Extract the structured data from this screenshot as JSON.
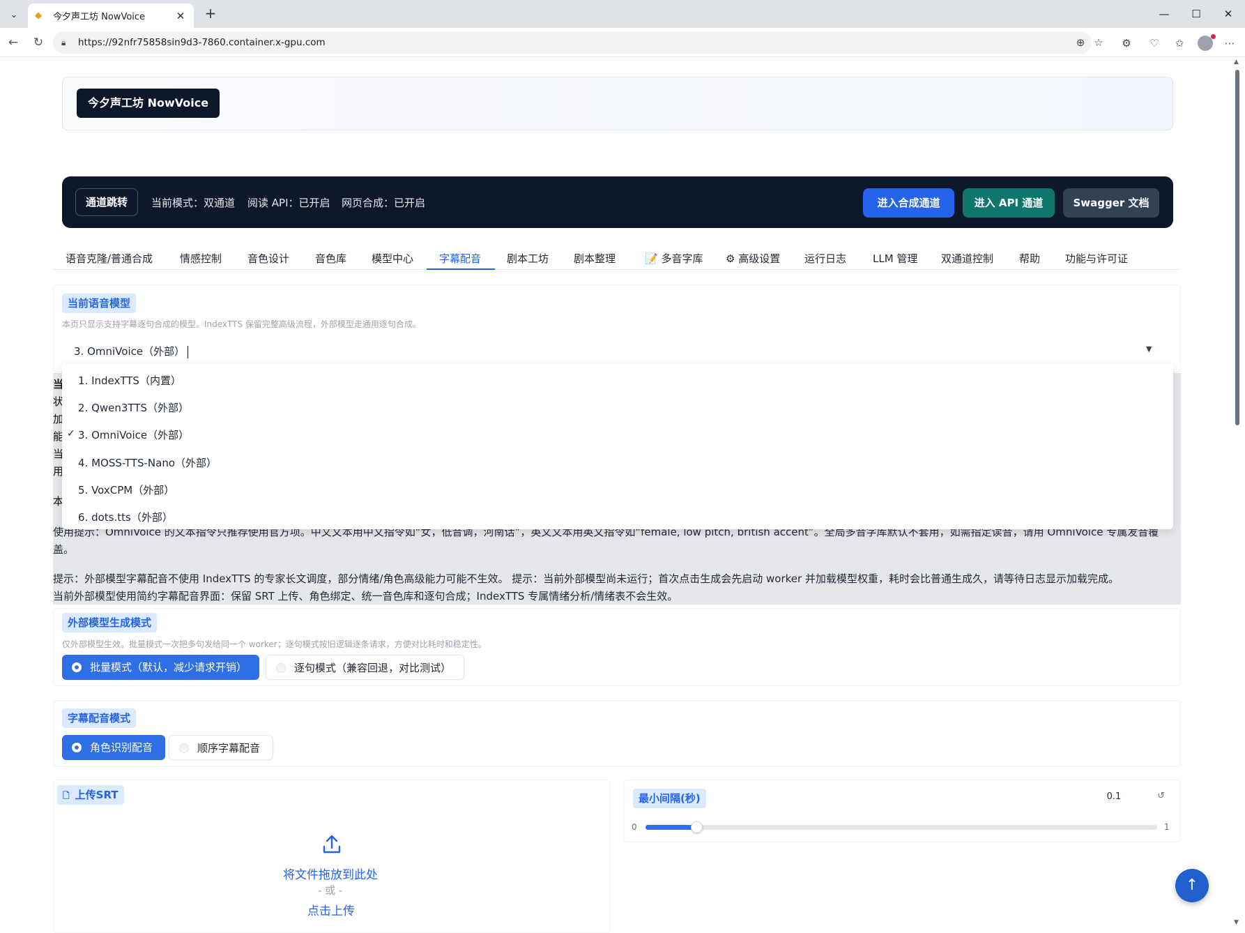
{
  "browser": {
    "tab_title": "今夕声工坊 NowVoice",
    "url": "https://92nfr75858sin9d3-7860.container.x-gpu.com"
  },
  "header": {
    "brand": "今夕声工坊 NowVoice"
  },
  "channel_bar": {
    "label": "通道跳转",
    "mode": "当前模式：双通道",
    "read_api": "阅读 API：已开启",
    "web_synth": "网页合成：已开启",
    "btn_synth": "进入合成通道",
    "btn_api": "进入 API 通道",
    "btn_swagger": "Swagger 文档",
    "colors": {
      "synth": "#2563eb",
      "api": "#0f766e",
      "swagger": "#334155"
    }
  },
  "tabs": [
    "语音克隆/普通合成",
    "情感控制",
    "音色设计",
    "音色库",
    "模型中心",
    "字幕配音",
    "剧本工坊",
    "剧本整理",
    "📝 多音字库",
    "⚙ 高级设置",
    "运行日志",
    "LLM 管理",
    "双通道控制",
    "帮助",
    "功能与许可证"
  ],
  "active_tab": "字幕配音",
  "model_section": {
    "label": "当前语音模型",
    "hint": "本页只显示支持字幕逐句合成的模型。IndexTTS 保留完整高级流程，外部模型走通用逐句合成。",
    "selected": "3. OmniVoice（外部）",
    "options": [
      "1. IndexTTS（内置）",
      "2. Qwen3TTS（外部）",
      "3. OmniVoice（外部）",
      "4. MOSS-TTS-Nano（外部）",
      "5. VoxCPM（外部）",
      "6. dots.tts（外部）"
    ],
    "checked_index": 2
  },
  "info": {
    "side_chars": [
      "当",
      "状",
      "加",
      "能",
      "当",
      "用",
      "本"
    ],
    "line_usage": "使用提示：OmniVoice 的文本指令只推荐使用官方项。中文文本用中文指令如“女，低音调，河南话”，英文文本用英文指令如“female, low pitch, british accent”。全局多音字库默认不套用，如需指定读音，请用 OmniVoice 专属发音覆",
    "line_usage_2": "盖。",
    "line_tip": "提示：外部模型字幕配音不使用 IndexTTS 的专家长文调度，部分情绪/角色高级能力可能不生效。 提示：当前外部模型尚未运行；首次点击生成会先启动 worker 并加载模型权重，耗时会比普通生成久，请等待日志显示加载完成。",
    "line_simple": "当前外部模型使用简约字幕配音界面：保留 SRT 上传、角色绑定、统一音色库和逐句合成；IndexTTS 专属情绪分析/情绪表不会生效。"
  },
  "gen_mode": {
    "label": "外部模型生成模式",
    "hint": "仅外部模型生效。批量模式一次把多句发给同一个 worker；逐句模式按旧逻辑逐条请求，方便对比耗时和稳定性。",
    "options": [
      "批量模式（默认，减少请求开销）",
      "逐句模式（兼容回退，对比测试）"
    ],
    "selected": 0
  },
  "dub_mode": {
    "label": "字幕配音模式",
    "options": [
      "角色识别配音",
      "顺序字幕配音"
    ],
    "selected": 0
  },
  "upload": {
    "label": "上传SRT",
    "drop": "将文件拖放到此处",
    "or": "- 或 -",
    "click": "点击上传"
  },
  "interval": {
    "label": "最小间隔(秒)",
    "value": "0.1",
    "min": "0",
    "max": "1",
    "fraction": 0.1
  }
}
